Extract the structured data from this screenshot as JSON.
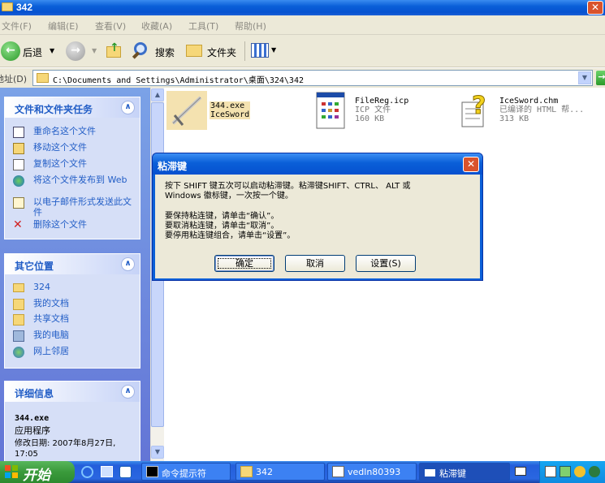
{
  "window": {
    "title": "342",
    "close_glyph": "✕"
  },
  "menu": [
    "文件(F)",
    "编辑(E)",
    "查看(V)",
    "收藏(A)",
    "工具(T)",
    "帮助(H)"
  ],
  "toolbar": {
    "back": "后退",
    "search": "搜索",
    "folders": "文件夹"
  },
  "address": {
    "label": "地址(D)",
    "path": "C:\\Documents and Settings\\Administrator\\桌面\\324\\342"
  },
  "sidebar": {
    "tasks": {
      "title": "文件和文件夹任务",
      "items": [
        {
          "label": "重命名这个文件",
          "icon": "rename-icon"
        },
        {
          "label": "移动这个文件",
          "icon": "move-icon"
        },
        {
          "label": "复制这个文件",
          "icon": "copy-icon"
        },
        {
          "label": "将这个文件发布到 Web",
          "icon": "web-publish-icon"
        },
        {
          "label": "以电子邮件形式发送此文件",
          "icon": "email-icon"
        },
        {
          "label": "删除这个文件",
          "icon": "delete-icon"
        }
      ]
    },
    "places": {
      "title": "其它位置",
      "items": [
        {
          "label": "324",
          "icon": "folder-icon"
        },
        {
          "label": "我的文档",
          "icon": "my-documents-icon"
        },
        {
          "label": "共享文档",
          "icon": "shared-documents-icon"
        },
        {
          "label": "我的电脑",
          "icon": "my-computer-icon"
        },
        {
          "label": "网上邻居",
          "icon": "network-icon"
        }
      ]
    },
    "details": {
      "title": "详细信息",
      "name": "344.exe",
      "type": "应用程序",
      "modified": "修改日期: 2007年8月27日, 17:05"
    }
  },
  "files": [
    {
      "name": "344.exe",
      "sub1": "IceSword",
      "sub2": "",
      "icon": "sword-icon"
    },
    {
      "name": "FileReg.icp",
      "sub1": "ICP 文件",
      "sub2": "160 KB",
      "icon": "icp-file-icon"
    },
    {
      "name": "IceSword.chm",
      "sub1": "已编译的 HTML 帮...",
      "sub2": "313 KB",
      "icon": "chm-help-icon"
    }
  ],
  "dialog": {
    "title": "粘滞键",
    "line1": "按下 SHIFT 键五次可以启动粘滞键。粘滞键SHIFT、CTRL、 ALT 或",
    "line2": "Windows 徽标键，一次按一个键。",
    "line3": "要保持粘连键，请单击“确认”。",
    "line4": "要取消粘连键，请单击“取消”。",
    "line5": "要停用粘连键组合，请单击“设置”。",
    "ok": "确定",
    "cancel": "取消",
    "settings": "设置(S)"
  },
  "taskbar": {
    "start": "开始",
    "tasks": [
      {
        "label": "命令提示符",
        "icon": "cmd-icon"
      },
      {
        "label": "342",
        "icon": "folder-icon"
      },
      {
        "label": "vedln80393",
        "icon": "image-icon"
      },
      {
        "label": "粘滞键",
        "icon": "window-icon"
      }
    ]
  },
  "colors": {
    "accent": "#0a5fd8",
    "link": "#215dc6",
    "close": "#d9532c",
    "start": "#3a9a3b"
  }
}
